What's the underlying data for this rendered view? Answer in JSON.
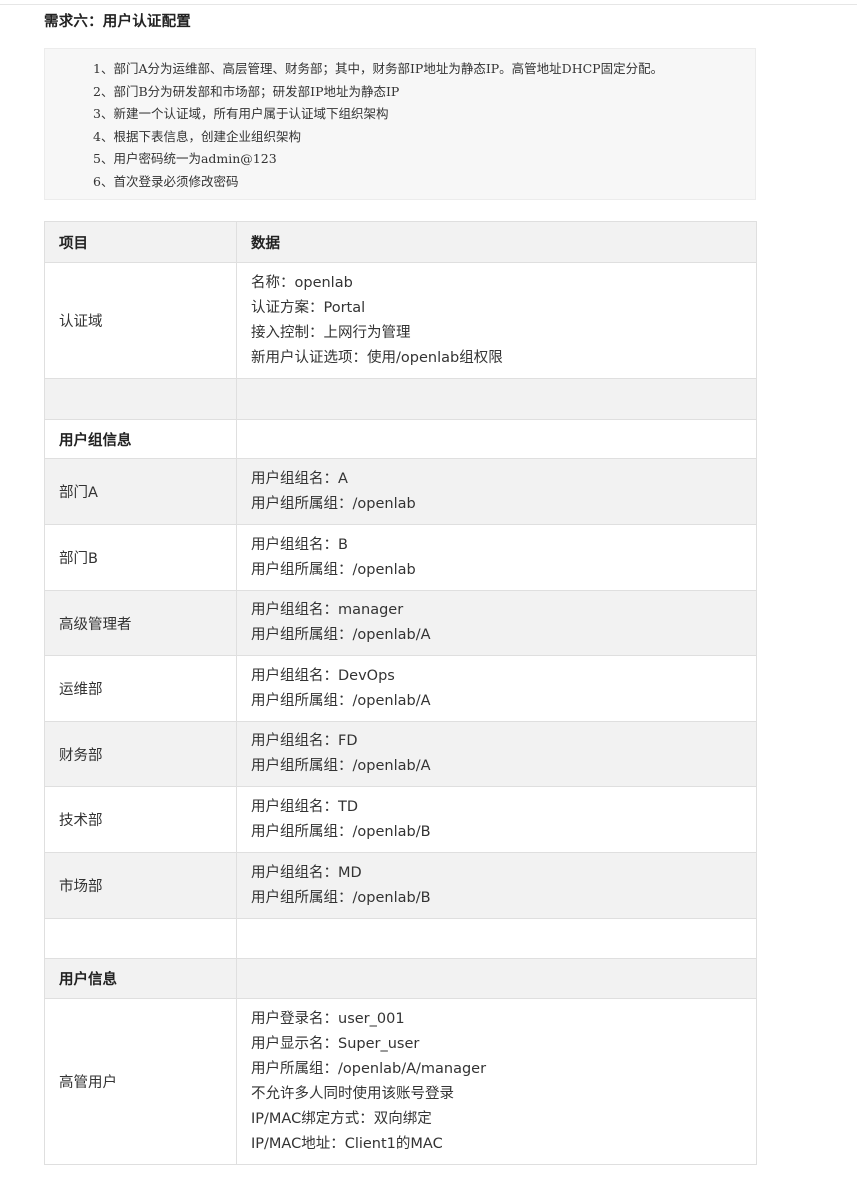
{
  "heading": "需求六：用户认证配置",
  "requirements": [
    "1、部门A分为运维部、高层管理、财务部；其中，财务部IP地址为静态IP。高管地址DHCP固定分配。",
    "2、部门B分为研发部和市场部；研发部IP地址为静态IP",
    "3、新建一个认证域，所有用户属于认证域下组织架构",
    "4、根据下表信息，创建企业组织架构",
    "5、用户密码统一为admin@123",
    "6、首次登录必须修改密码"
  ],
  "table": {
    "headers": [
      "项目",
      "数据"
    ],
    "rows": [
      {
        "key": "认证域",
        "bold": false,
        "lines": [
          "名称：openlab",
          "认证方案：Portal",
          "接入控制：上网行为管理",
          "新用户认证选项：使用/openlab组权限"
        ]
      },
      {
        "key": "",
        "bold": false,
        "lines": []
      },
      {
        "key": "用户组信息",
        "bold": true,
        "lines": []
      },
      {
        "key": "部门A",
        "bold": false,
        "lines": [
          "用户组组名：A",
          "用户组所属组：/openlab"
        ]
      },
      {
        "key": "部门B",
        "bold": false,
        "lines": [
          "用户组组名：B",
          "用户组所属组：/openlab"
        ]
      },
      {
        "key": "高级管理者",
        "bold": false,
        "lines": [
          "用户组组名：manager",
          "用户组所属组：/openlab/A"
        ]
      },
      {
        "key": "运维部",
        "bold": false,
        "lines": [
          "用户组组名：DevOps",
          "用户组所属组：/openlab/A"
        ]
      },
      {
        "key": "财务部",
        "bold": false,
        "lines": [
          "用户组组名：FD",
          "用户组所属组：/openlab/A"
        ]
      },
      {
        "key": "技术部",
        "bold": false,
        "lines": [
          "用户组组名：TD",
          "用户组所属组：/openlab/B"
        ]
      },
      {
        "key": "市场部",
        "bold": false,
        "lines": [
          "用户组组名：MD",
          "用户组所属组：/openlab/B"
        ]
      },
      {
        "key": "",
        "bold": false,
        "lines": []
      },
      {
        "key": "用户信息",
        "bold": true,
        "lines": []
      },
      {
        "key": "高管用户",
        "bold": false,
        "lines": [
          "用户登录名：user_001",
          "用户显示名：Super_user",
          "用户所属组：/openlab/A/manager",
          "不允许多人同时使用该账号登录",
          "IP/MAC绑定方式：双向绑定",
          "IP/MAC地址：Client1的MAC"
        ]
      }
    ]
  }
}
